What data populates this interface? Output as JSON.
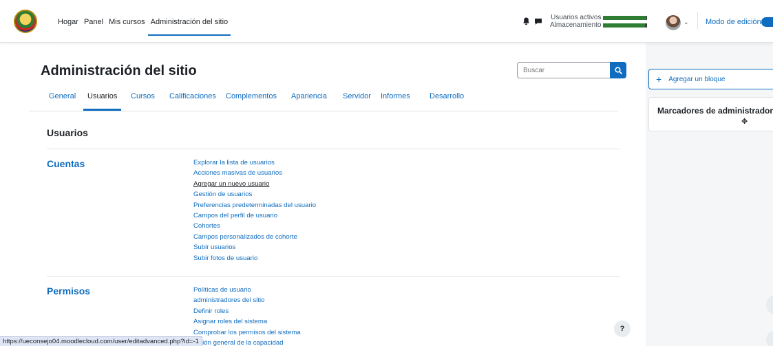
{
  "nav": {
    "links": [
      "Hogar",
      "Panel",
      "Mis cursos",
      "Administración del sitio"
    ],
    "active_index": 3,
    "meters": [
      {
        "label": "Usuarios activos",
        "fill": 0.97
      },
      {
        "label": "Almacenamiento",
        "fill": 0.94
      }
    ],
    "edit_mode_label": "Modo de edición",
    "icons": {
      "bell": "bell-icon",
      "chat": "chat-icon",
      "caret": "chevron-down-icon"
    }
  },
  "page": {
    "title": "Administración del sitio",
    "search_placeholder": "Buscar"
  },
  "tabs": [
    {
      "label": "General"
    },
    {
      "label": "Usuarios"
    },
    {
      "label": "Cursos"
    },
    {
      "label": "Calificaciones"
    },
    {
      "label": "Complementos"
    },
    {
      "label": "Apariencia"
    },
    {
      "label": "Servidor"
    },
    {
      "label": "Informes"
    },
    {
      "label": "Desarrollo"
    }
  ],
  "active_tab": 1,
  "section": {
    "heading": "Usuarios",
    "categories": [
      {
        "title": "Cuentas",
        "links": [
          "Explorar la lista de usuarios",
          "Acciones masivas de usuarios",
          "Agregar un nuevo usuario",
          "Gestión de usuarios",
          "Preferencias predeterminadas del usuario",
          "Campos del perfil de usuario",
          "Cohortes",
          "Campos personalizados de cohorte",
          "Subir usuarios",
          "Subir fotos de usuario"
        ],
        "hovered_index": 2
      },
      {
        "title": "Permisos",
        "links": [
          "Políticas de usuario",
          "administradores del sitio",
          "Definir roles",
          "Asignar roles del sistema",
          "Comprobar los permisos del sistema",
          "Visión general de la capacidad"
        ],
        "hovered_index": -1
      }
    ]
  },
  "drawer": {
    "add_block_label": "Agregar un bloque",
    "block_title": "Marcadores de administrador"
  },
  "help_label": "?",
  "status_url": "https://ueconsejo04.moodlecloud.com/user/editadvanced.php?id=-1"
}
